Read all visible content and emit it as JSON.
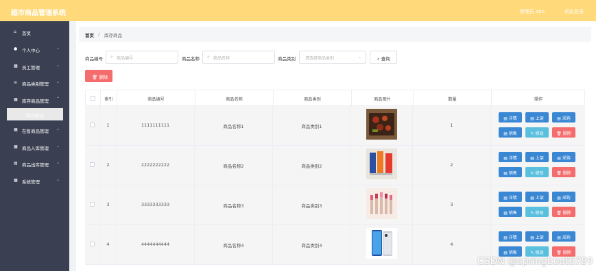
{
  "header": {
    "title": "超市商品管理系统",
    "user": "管理员 abo",
    "logout": "退出登录"
  },
  "sidebar": {
    "items": [
      {
        "label": "首页",
        "icon": "home-icon"
      },
      {
        "label": "个人中心",
        "icon": "user-icon"
      },
      {
        "label": "员工管理",
        "icon": "grid-icon"
      },
      {
        "label": "商品类别管理",
        "icon": "list-icon"
      },
      {
        "label": "库存商品管理",
        "icon": "grid-icon"
      },
      {
        "label": "在售商品管理",
        "icon": "grid-icon"
      },
      {
        "label": "商品入库管理",
        "icon": "grid-icon"
      },
      {
        "label": "商品出库管理",
        "icon": "storage-icon"
      },
      {
        "label": "系统管理",
        "icon": "grid-icon"
      }
    ],
    "active_sub": "库存商品"
  },
  "breadcrumb": {
    "home": "首页",
    "sep": "/",
    "current": "库存商品"
  },
  "filters": {
    "code_label": "商品编号",
    "code_placeholder": "商品编号",
    "name_label": "商品名称",
    "name_placeholder": "商品名称",
    "cat_label": "商品类别",
    "cat_placeholder": "请选择商品类别",
    "query": "查询"
  },
  "toolbar": {
    "delete": "删除"
  },
  "table": {
    "headers": [
      "索引",
      "商品编号",
      "商品名称",
      "商品类别",
      "商品图片",
      "数量",
      "操作"
    ],
    "rows": [
      {
        "idx": "1",
        "code": "1111111111",
        "name": "商品名称1",
        "cat": "商品类别1",
        "qty": "1"
      },
      {
        "idx": "2",
        "code": "2222222222",
        "name": "商品名称2",
        "cat": "商品类别2",
        "qty": "2"
      },
      {
        "idx": "3",
        "code": "3333333333",
        "name": "商品名称3",
        "cat": "商品类别3",
        "qty": "3"
      },
      {
        "idx": "4",
        "code": "4444444444",
        "name": "商品名称4",
        "cat": "商品类别4",
        "qty": "4"
      }
    ],
    "actions": {
      "detail": "详情",
      "shelf": "上架",
      "purchase": "采购",
      "sell": "销售",
      "edit": "修改",
      "delete": "删除"
    }
  },
  "watermark": "CSDN @springboot6789",
  "colors": {
    "header": "#ffd97a",
    "sidebar": "#3a3f52",
    "blue": "#3a87d4",
    "teal": "#5bc0de",
    "red": "#f56c6c"
  }
}
